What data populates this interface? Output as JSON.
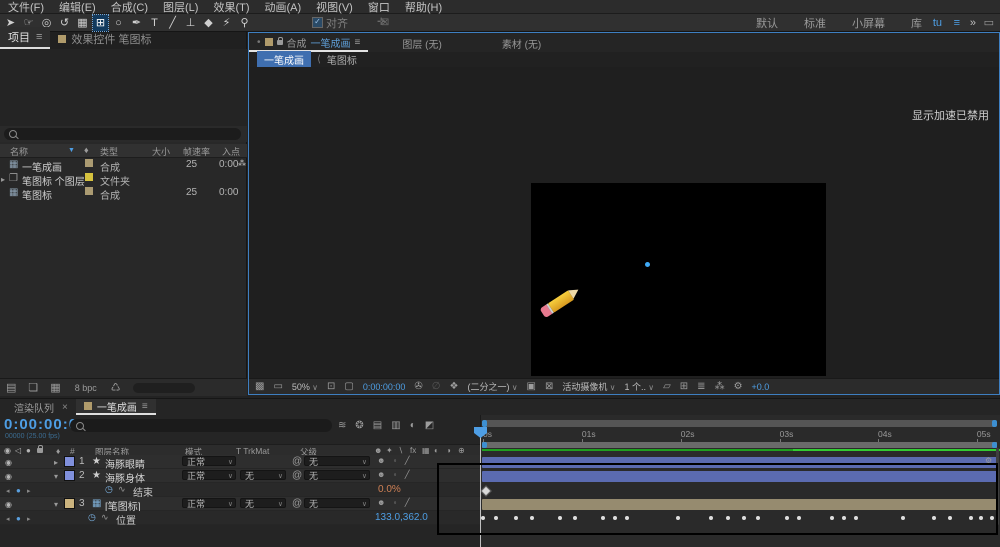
{
  "colors": {
    "accent_blue": "#4e9ee4",
    "selection_blue": "#3f6fb0",
    "layer_label_blue": "#8090dc",
    "layer_label_sand": "#cbb37e",
    "bar_blue": "#5b6bb0",
    "bar_sand": "#968b6f",
    "cache_green": "#2db32d",
    "value_orange": "#cf8055",
    "annotation_black": "#000000"
  },
  "menu_bar": {
    "items": [
      "文件(F)",
      "编辑(E)",
      "合成(C)",
      "图层(L)",
      "效果(T)",
      "动画(A)",
      "视图(V)",
      "窗口",
      "帮助(H)"
    ]
  },
  "toolbar": {
    "tools": [
      {
        "name": "selection-tool",
        "glyph": "➤",
        "active": false
      },
      {
        "name": "hand-tool",
        "glyph": "☞",
        "active": false
      },
      {
        "name": "zoom-tool",
        "glyph": "◎",
        "active": false
      },
      {
        "name": "rotation-tool",
        "glyph": "↺",
        "active": false
      },
      {
        "name": "camera-tool",
        "glyph": "▦",
        "active": false
      },
      {
        "name": "pan-behind-tool",
        "glyph": "⊞",
        "active": true
      },
      {
        "name": "shape-tool",
        "glyph": "○",
        "active": false
      },
      {
        "name": "pen-tool",
        "glyph": "✒",
        "active": false
      },
      {
        "name": "type-tool",
        "glyph": "T",
        "active": false
      },
      {
        "name": "brush-tool",
        "glyph": "╱",
        "active": false
      },
      {
        "name": "clone-stamp-tool",
        "glyph": "⊥",
        "active": false
      },
      {
        "name": "eraser-tool",
        "glyph": "◆",
        "active": false
      },
      {
        "name": "roto-brush-tool",
        "glyph": "⚡",
        "active": false
      },
      {
        "name": "puppet-pin-tool",
        "glyph": "⚲",
        "active": false
      }
    ],
    "snap_check": "✓",
    "snap_label": "对齐",
    "workspaces": [
      "默认",
      "标准",
      "小屏幕",
      "库"
    ],
    "workspace_more": "tu",
    "menu_icon": "≡",
    "overflow_icon": "»",
    "layout_icon": "▭"
  },
  "project_panel": {
    "tab_project": "项目",
    "tab_effects": "效果控件 笔图标",
    "columns": {
      "name": "名称",
      "type": "类型",
      "size": "大小",
      "fps": "帧速率",
      "in": "入点"
    },
    "sort_arrow": "▼",
    "tag_icon": "♦",
    "rows": [
      {
        "icon": "▦",
        "name": "一笔成画",
        "type": "合成",
        "fps": "25",
        "in_point": "0:00",
        "usage_icon": "⁂",
        "label_color": "#ab9b72"
      },
      {
        "expander": "▸",
        "icon": "❐",
        "name": "笔图标 个图层",
        "type": "文件夹",
        "label_color": "#d6c23e"
      },
      {
        "icon": "▦",
        "name": "笔图标",
        "type": "合成",
        "fps": "25",
        "in_point": "0:00",
        "label_color": "#ab9b72"
      }
    ],
    "bit_depth": "8 bpc",
    "bottom_icons": [
      {
        "name": "interpret-footage-icon",
        "glyph": "▤"
      },
      {
        "name": "new-folder-icon",
        "glyph": "❏"
      },
      {
        "name": "new-composition-icon",
        "glyph": "▦"
      },
      {
        "name": "delete-icon",
        "glyph": "♺"
      }
    ]
  },
  "comp_panel": {
    "tab_bullet": "•",
    "tab_prefix": "合成",
    "tab_title": "一笔成画",
    "tab_menu_icon": "≡",
    "tab_layer": "图层 (无)",
    "tab_footage": "素材 (无)",
    "sub_tabs": [
      "一笔成画",
      "笔图标"
    ],
    "sub_tab_sep": "⟨",
    "gpu_notice": "显示加速已禁用",
    "toolbar": {
      "items": [
        {
          "name": "magnification-grid-icon",
          "glyph": "▩",
          "kind": "icon"
        },
        {
          "name": "screen-mode-icon",
          "glyph": "▭",
          "kind": "icon"
        },
        {
          "name": "zoom-level-dropdown",
          "text": "50%",
          "kind": "dropdown"
        },
        {
          "name": "rulers-icon",
          "glyph": "⊡",
          "kind": "icon"
        },
        {
          "name": "region-of-interest-icon",
          "glyph": "▢",
          "kind": "icon"
        },
        {
          "name": "preview-timecode",
          "text": "0:00:00:00",
          "kind": "timecode"
        },
        {
          "name": "snapshot-icon",
          "glyph": "✇",
          "kind": "icon"
        },
        {
          "name": "show-snapshot-icon",
          "glyph": "∅",
          "kind": "icon-dim"
        },
        {
          "name": "channels-icon",
          "glyph": "❖",
          "kind": "icon"
        },
        {
          "name": "resolution-dropdown",
          "text": "(二分之一)",
          "kind": "dropdown"
        },
        {
          "name": "fast-previews-icon",
          "glyph": "▣",
          "kind": "icon"
        },
        {
          "name": "toggle-transparency-icon",
          "glyph": "⊠",
          "kind": "icon"
        },
        {
          "name": "camera-view-dropdown",
          "text": "活动摄像机",
          "kind": "dropdown"
        },
        {
          "name": "view-layout-dropdown",
          "text": "1 个..",
          "kind": "dropdown"
        },
        {
          "name": "pixel-aspect-icon",
          "glyph": "▱",
          "kind": "icon"
        },
        {
          "name": "grid-guides-icon",
          "glyph": "⊞",
          "kind": "icon"
        },
        {
          "name": "exposure-histogram-icon",
          "glyph": "≣",
          "kind": "icon"
        },
        {
          "name": "flowchart-icon",
          "glyph": "⁂",
          "kind": "icon"
        },
        {
          "name": "reset-exposure-icon",
          "glyph": "⚙",
          "kind": "icon"
        },
        {
          "name": "exposure-value",
          "text": "+0.0",
          "kind": "blue-text"
        }
      ]
    }
  },
  "timeline": {
    "tab_render_queue": "渲染队列",
    "close_icon": "×",
    "tab_comp": "一笔成画",
    "tab_menu_icon": "≡",
    "timecode": "0:00:00:00",
    "frame_info": "00000 (25.00 fps)",
    "mini_icons": [
      {
        "name": "mini-flowchart-icon",
        "glyph": "≋"
      },
      {
        "name": "draft-3d-icon",
        "glyph": "❂"
      },
      {
        "name": "hide-shy-icon",
        "glyph": "▤"
      },
      {
        "name": "frame-blend-icon",
        "glyph": "▥"
      },
      {
        "name": "motion-blur-icon",
        "glyph": "◐"
      },
      {
        "name": "graph-editor-icon",
        "glyph": "◩"
      }
    ],
    "columns": {
      "layer_name": "图层名称",
      "mode": "模式",
      "trkmat": "T TrkMat",
      "parent": "父级"
    },
    "switch_header_glyphs": [
      "☻",
      "✦",
      "∖",
      "fx",
      "▦",
      "◐",
      "◑",
      "⊕"
    ],
    "layers": [
      {
        "index": "1",
        "name": "海豚眼睛",
        "icon": "★",
        "mode": "正常",
        "parent": "无",
        "expander": "▸"
      },
      {
        "index": "2",
        "name": "海豚身体",
        "icon": "★",
        "mode": "正常",
        "trkmat": "无",
        "parent": "无",
        "expander": "▾"
      },
      {
        "index": "3",
        "name": "[笔图标]",
        "icon": "▦",
        "mode": "正常",
        "trkmat": "无",
        "parent": "无",
        "expander": "▾"
      }
    ],
    "properties": [
      {
        "name": "结束",
        "value": "0.0%"
      },
      {
        "name": "位置",
        "value": "133.0,362.0"
      }
    ],
    "none_label": "无",
    "layer_switch_glyphs": "☻ ◦ ╱",
    "ruler_ticks": [
      {
        "label": "0s",
        "pct": 0.2
      },
      {
        "label": "01s",
        "pct": 19.4
      },
      {
        "label": "02s",
        "pct": 38.6
      },
      {
        "label": "03s",
        "pct": 57.8
      },
      {
        "label": "04s",
        "pct": 76.9
      },
      {
        "label": "05s",
        "pct": 96.1
      }
    ],
    "position_keyframes_pct": [
      0.2,
      2.7,
      6.6,
      9.7,
      15.1,
      18.0,
      23.4,
      25.8,
      28.1,
      38.0,
      44.4,
      47.7,
      50.8,
      53.5,
      59.3,
      61.6,
      68.0,
      70.3,
      72.7,
      81.8,
      87.8,
      90.9,
      95.0,
      96.9,
      99.0
    ],
    "end_keyframe_pct": 0.2
  },
  "icons": {
    "eye": "◉",
    "audio": "◁",
    "solo": "●",
    "pickwhip": "@",
    "stopwatch": "◷",
    "graph": "∿",
    "search": "search-icon",
    "gear": "⚙"
  }
}
